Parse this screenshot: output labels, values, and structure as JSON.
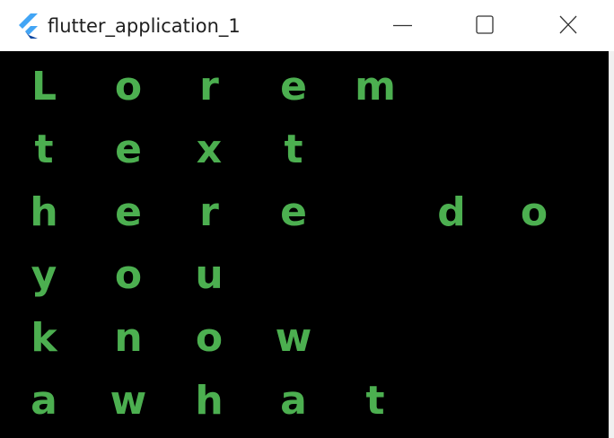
{
  "window": {
    "title": "flutter_application_1",
    "controls": [
      "minimize",
      "maximize",
      "close"
    ]
  },
  "colors": {
    "text": "#4CAF50",
    "background": "#000000",
    "titlebar": "#FFFFFF",
    "icon_light": "#42A5F5",
    "icon_dark": "#0D47A1"
  },
  "icons": {
    "app": "flutter-logo-icon",
    "minimize": "minimize-icon",
    "maximize": "maximize-icon",
    "close": "close-icon"
  },
  "content": {
    "rows": [
      [
        "L",
        "o",
        "r",
        "e",
        "m"
      ],
      [
        "t",
        "e",
        "x",
        "t"
      ],
      [
        "h",
        "e",
        "r",
        "e",
        "",
        "d",
        "o"
      ],
      [
        "y",
        "o",
        "u"
      ],
      [
        "k",
        "n",
        "o",
        "w"
      ],
      [
        "a",
        "w",
        "h",
        "a",
        "t"
      ]
    ]
  }
}
